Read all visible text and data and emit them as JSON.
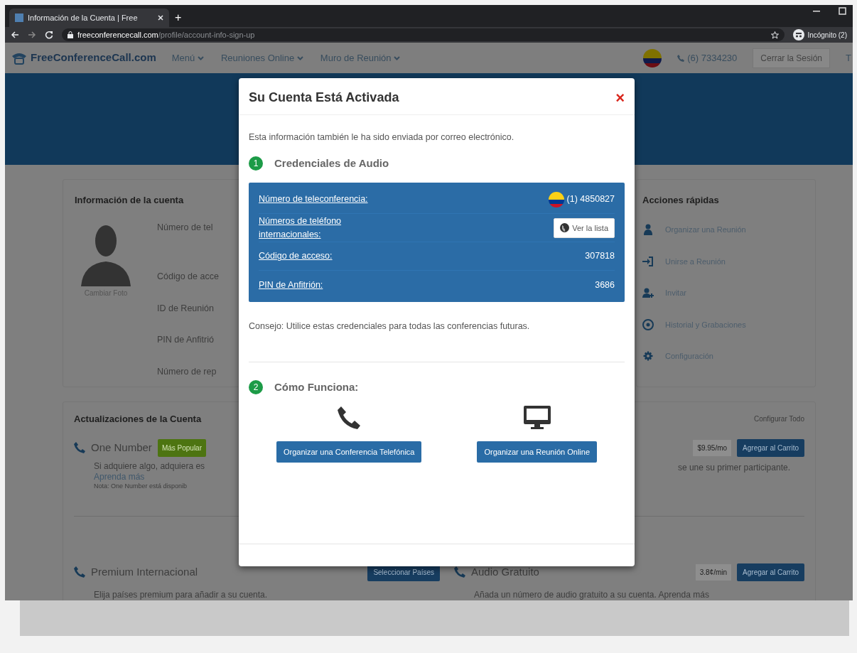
{
  "browser": {
    "tab_title": "Información de la Cuenta | Free",
    "new_tab": "+",
    "url_host": "freeconferencecall.com",
    "url_path": "/profile/account-info-sign-up",
    "profile_label": "Incógnito (2)"
  },
  "navbar": {
    "logo": "FreeConferenceCall.com",
    "menus": [
      "Menú",
      "Reuniones Online",
      "Muro de Reunión"
    ],
    "phone": "(6) 7334230",
    "logout": "Cerrar la Sesión",
    "cut_item": "T"
  },
  "account_info": {
    "title": "Información de la cuenta",
    "change_photo": "Cambiar Foto",
    "fields": [
      "Número de tel",
      "Código de acce",
      "ID de Reunión",
      "PIN de Anfitrió",
      "Número de rep"
    ]
  },
  "quick_actions": {
    "title": "Acciones rápidas",
    "items": [
      {
        "label": "Organizar una Reunión",
        "kind": "user"
      },
      {
        "label": "Unirse a Reunión",
        "kind": "join"
      },
      {
        "label": "Invitar",
        "kind": "invite"
      },
      {
        "label": "Historial y Grabaciones",
        "kind": "history"
      },
      {
        "label": "Configuración",
        "kind": "settings"
      }
    ]
  },
  "updates": {
    "title": "Actualizaciones de la Cuenta",
    "configure_all": "Configurar Todo",
    "one_number": {
      "name": "One Number",
      "badge": "Más Popular",
      "description": "Si adquiere algo, adquiera es",
      "description_end": "se une su primer participante.",
      "learn_more": "Aprenda más",
      "note": "Nota: One Number está disponib",
      "price": "$9.95/mo",
      "button": "Agregar al Carrito"
    },
    "premium": {
      "name": "Premium Internacional",
      "button": "Seleccionar Países",
      "description": "Elija países premium para añadir a su cuenta."
    },
    "free_audio": {
      "name": "Audio Gratuito",
      "price": "3.8¢/min",
      "button": "Agregar al Carrito",
      "description": "Añada un número de audio gratuito a su cuenta. Aprenda más"
    }
  },
  "modal": {
    "title": "Su Cuenta Está Activada",
    "close": "×",
    "intro": "Esta información también le ha sido enviada por correo electrónico.",
    "steps": [
      {
        "number": "1",
        "title": "Credenciales de Audio"
      },
      {
        "number": "2",
        "title": "Cómo Funciona:"
      }
    ],
    "credentials": [
      {
        "label": "Número de teleconferencia:",
        "value": "(1) 4850827",
        "kind": "phone"
      },
      {
        "label": "Números de teléfono internacionales:",
        "value": "Ver la lista",
        "kind": "button"
      },
      {
        "label": "Código de acceso:",
        "value": "307818",
        "kind": "text"
      },
      {
        "label": "PIN de Anfitrión:",
        "value": "3686",
        "kind": "text"
      }
    ],
    "tip": "Consejo: Utilice estas credenciales para todas las conferencias futuras.",
    "actions": [
      {
        "kind": "phone",
        "button": "Organizar una Conferencia Telefónica"
      },
      {
        "kind": "monitor",
        "button": "Organizar una Reunión Online"
      }
    ]
  }
}
